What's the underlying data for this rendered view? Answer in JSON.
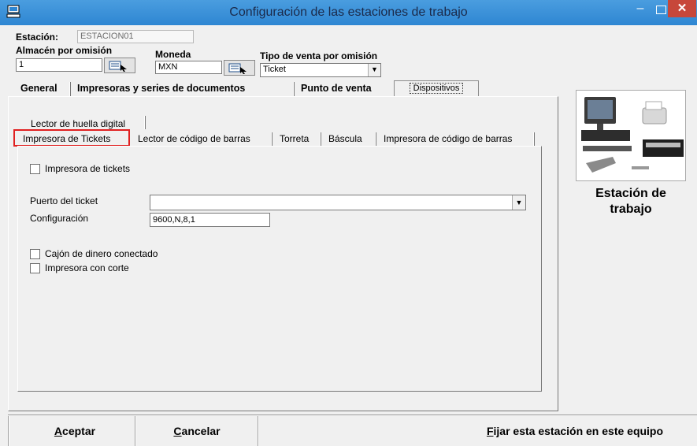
{
  "window": {
    "title": "Configuración de las estaciones de trabajo"
  },
  "header": {
    "estacion_label": "Estación:",
    "estacion_value": "ESTACION01",
    "almacen_label": "Almacén por omisión",
    "almacen_value": "1",
    "moneda_label": "Moneda",
    "moneda_value": "MXN",
    "tipo_venta_label": "Tipo de venta por omisión",
    "tipo_venta_value": "Ticket"
  },
  "tabs": [
    "General",
    "Impresoras  y series de documentos",
    "Punto de venta",
    "Dispositivos"
  ],
  "device_tabs": {
    "row1": [
      "Lector de huella digital"
    ],
    "row2": [
      "Impresora de Tickets",
      "Lector de código de barras",
      "Torreta",
      "Báscula",
      "Impresora de código de barras"
    ]
  },
  "ticket_printer": {
    "enable_label": "Impresora de tickets",
    "puerto_label": "Puerto del ticket",
    "puerto_value": "",
    "config_label": "Configuración",
    "config_value": "9600,N,8,1",
    "cajon_label": "Cajón de dinero conectado",
    "corte_label": "Impresora con corte"
  },
  "side": {
    "caption_line1": "Estación de",
    "caption_line2": "trabajo"
  },
  "buttons": {
    "accept_mnemonic": "A",
    "accept_rest": "ceptar",
    "cancel_mnemonic": "C",
    "cancel_rest": "ancelar",
    "fix_mnemonic": "F",
    "fix_rest": "ijar esta estación en este equipo"
  },
  "colors": {
    "titlebar": "#3a93d9",
    "close": "#c7473a",
    "highlight": "#e02020"
  }
}
